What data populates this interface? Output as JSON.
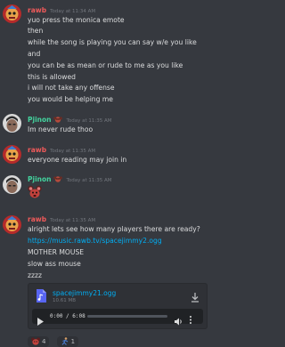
{
  "colors": {
    "background": "#36393f",
    "rawb_name": "#f05a5a",
    "pjinon_name": "#43d39e",
    "link": "#00aff4",
    "timestamp": "#72767d",
    "progress_accent": "#5865f2"
  },
  "messages": [
    {
      "author": "rawb",
      "timestamp": "Today at 11:34 AM",
      "avatar_icon": "rawb-avatar-icon",
      "lines": [
        "yuo press the monica emote",
        "then",
        "while the song is playing you can say w/e you like",
        "and",
        "you can be as mean or rude to me as you like",
        "this is allowed",
        "i will not take any offense",
        "you would be helping me"
      ]
    },
    {
      "author": "Pjinon",
      "timestamp": "Today at 11:35 AM",
      "avatar_icon": "pjinon-avatar-icon",
      "badge_icon": "monkey-badge-icon",
      "lines": [
        "Im never rude thoo"
      ]
    },
    {
      "author": "rawb",
      "timestamp": "Today at 11:35 AM",
      "avatar_icon": "rawb-avatar-icon",
      "lines": [
        "everyone reading may join in"
      ]
    },
    {
      "author": "Pjinon",
      "timestamp": "Today at 11:35 AM",
      "avatar_icon": "pjinon-avatar-icon",
      "badge_icon": "monkey-badge-icon",
      "emote_icon": "mouse-emote-icon"
    },
    {
      "author": "rawb",
      "timestamp": "Today at 11:35 AM",
      "avatar_icon": "rawb-avatar-icon",
      "lines": [
        "alright lets see how many players there are ready?"
      ],
      "link": "https://music.rawb.tv/spacejimmy2.ogg",
      "lines_after": [
        "MOTHER MOUSE",
        "slow ass mouse",
        "zzzz"
      ]
    }
  ],
  "attachment": {
    "file_name": "spacejimmy21.ogg",
    "file_size": "10.61 MB",
    "time": "0:00 / 6:08",
    "progress": 0.0
  },
  "reactions": [
    {
      "icon": "mouse-face-reaction-icon",
      "count": "4"
    },
    {
      "icon": "runner-reaction-icon",
      "count": "1"
    }
  ]
}
